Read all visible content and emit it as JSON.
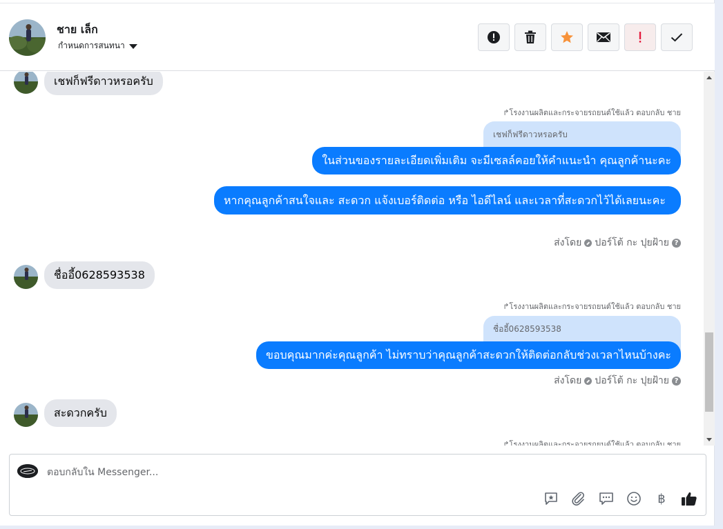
{
  "contact": {
    "name": "ชาย เล็ก",
    "status_label": "กำหนดการสนทนา"
  },
  "toolbar": {
    "icons": [
      "report-icon",
      "trash-icon",
      "star-icon",
      "envelope-icon",
      "exclamation-icon",
      "check-icon"
    ],
    "star_color": "#f7923a",
    "alert_color": "#e41e3f"
  },
  "messages": [
    {
      "direction": "in",
      "text": "เชฟก็ฟรีดาวหรอครับ"
    },
    {
      "direction": "out",
      "reply_meta": "↱โรงงานผลิตและกระจายรถยนต์ใช้แล้ว ตอบกลับ ชาย",
      "quoted": "เชฟก็ฟรีดาวหรอครับ",
      "text": "ในส่วนของรายละเอียดเพิ่มเติม จะมีเซลล์คอยให้คำแนะนำ คุณลูกค้านะคะ"
    },
    {
      "direction": "out",
      "text": "หากคุณลูกค้าสนใจและ สะดวก แจ้งเบอร์ติดต่อ หรือ ไอดีไลน์ และเวลาที่สะดวกไว้ได้เลยนะคะ",
      "sent_by": "ส่งโดย",
      "sender": "ปอร์โต้ กะ ปุยฝ้าย"
    },
    {
      "direction": "in",
      "text": "ชื่ออี้0628593538"
    },
    {
      "direction": "out",
      "reply_meta": "↱โรงงานผลิตและกระจายรถยนต์ใช้แล้ว ตอบกลับ ชาย",
      "quoted": "ชื่ออี้0628593538",
      "text": "ขอบคุณมากค่ะคุณลูกค้า ไม่ทราบว่าคุณลูกค้าสะดวกให้ติดต่อกลับช่วงเวลาไหนบ้างคะ",
      "sent_by": "ส่งโดย",
      "sender": "ปอร์โต้ กะ ปุยฝ้าย"
    },
    {
      "direction": "in",
      "text": "สะดวกครับ"
    },
    {
      "direction": "out",
      "reply_meta": "↱โรงงานผลิตและกระจายรถยนต์ใช้แล้ว ตอบกลับ ชาย"
    }
  ],
  "composer": {
    "placeholder": "ตอบกลับใน Messenger...",
    "tools": [
      "saved-reply-icon",
      "attachment-icon",
      "chat-bubble-icon",
      "emoji-icon",
      "baht-icon",
      "thumbs-up-icon"
    ],
    "baht_symbol": "฿"
  },
  "colors": {
    "outgoing_bubble": "#0a7cff",
    "quoted_bubble": "#cfe3fc",
    "incoming_bubble": "#e4e6eb"
  }
}
